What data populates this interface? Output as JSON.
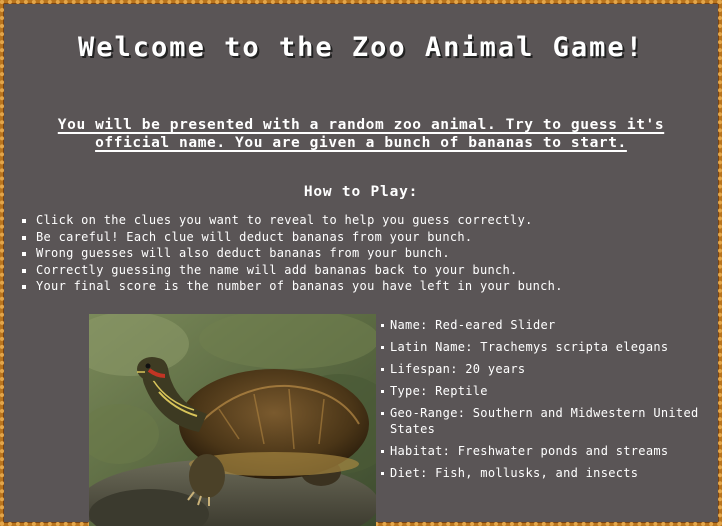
{
  "page": {
    "title": "Welcome to the Zoo Animal Game!",
    "intro": "You will be presented with a random zoo animal. Try to guess it's official name. You are given a bunch of bananas to start.",
    "how_to_heading": "How to Play:",
    "rules": [
      "Click on the clues you want to reveal to help you guess correctly.",
      "Be careful! Each clue will deduct bananas from your bunch.",
      "Wrong guesses will also deduct bananas from your bunch.",
      "Correctly guessing the name will add bananas back to your bunch.",
      "Your final score is the number of bananas you have left in your bunch."
    ]
  },
  "animal": {
    "image_subject": "red-eared slider turtle",
    "clues": [
      "Name: Red-eared Slider",
      "Latin Name: Trachemys scripta elegans",
      "Lifespan: 20 years",
      "Type: Reptile",
      "Geo-Range: Southern and Midwestern United States",
      "Habitat: Freshwater ponds and streams",
      "Diet: Fish, mollusks, and insects"
    ]
  },
  "colors": {
    "background": "#5a5556",
    "border": "#b8741d",
    "text": "#ffffff"
  }
}
